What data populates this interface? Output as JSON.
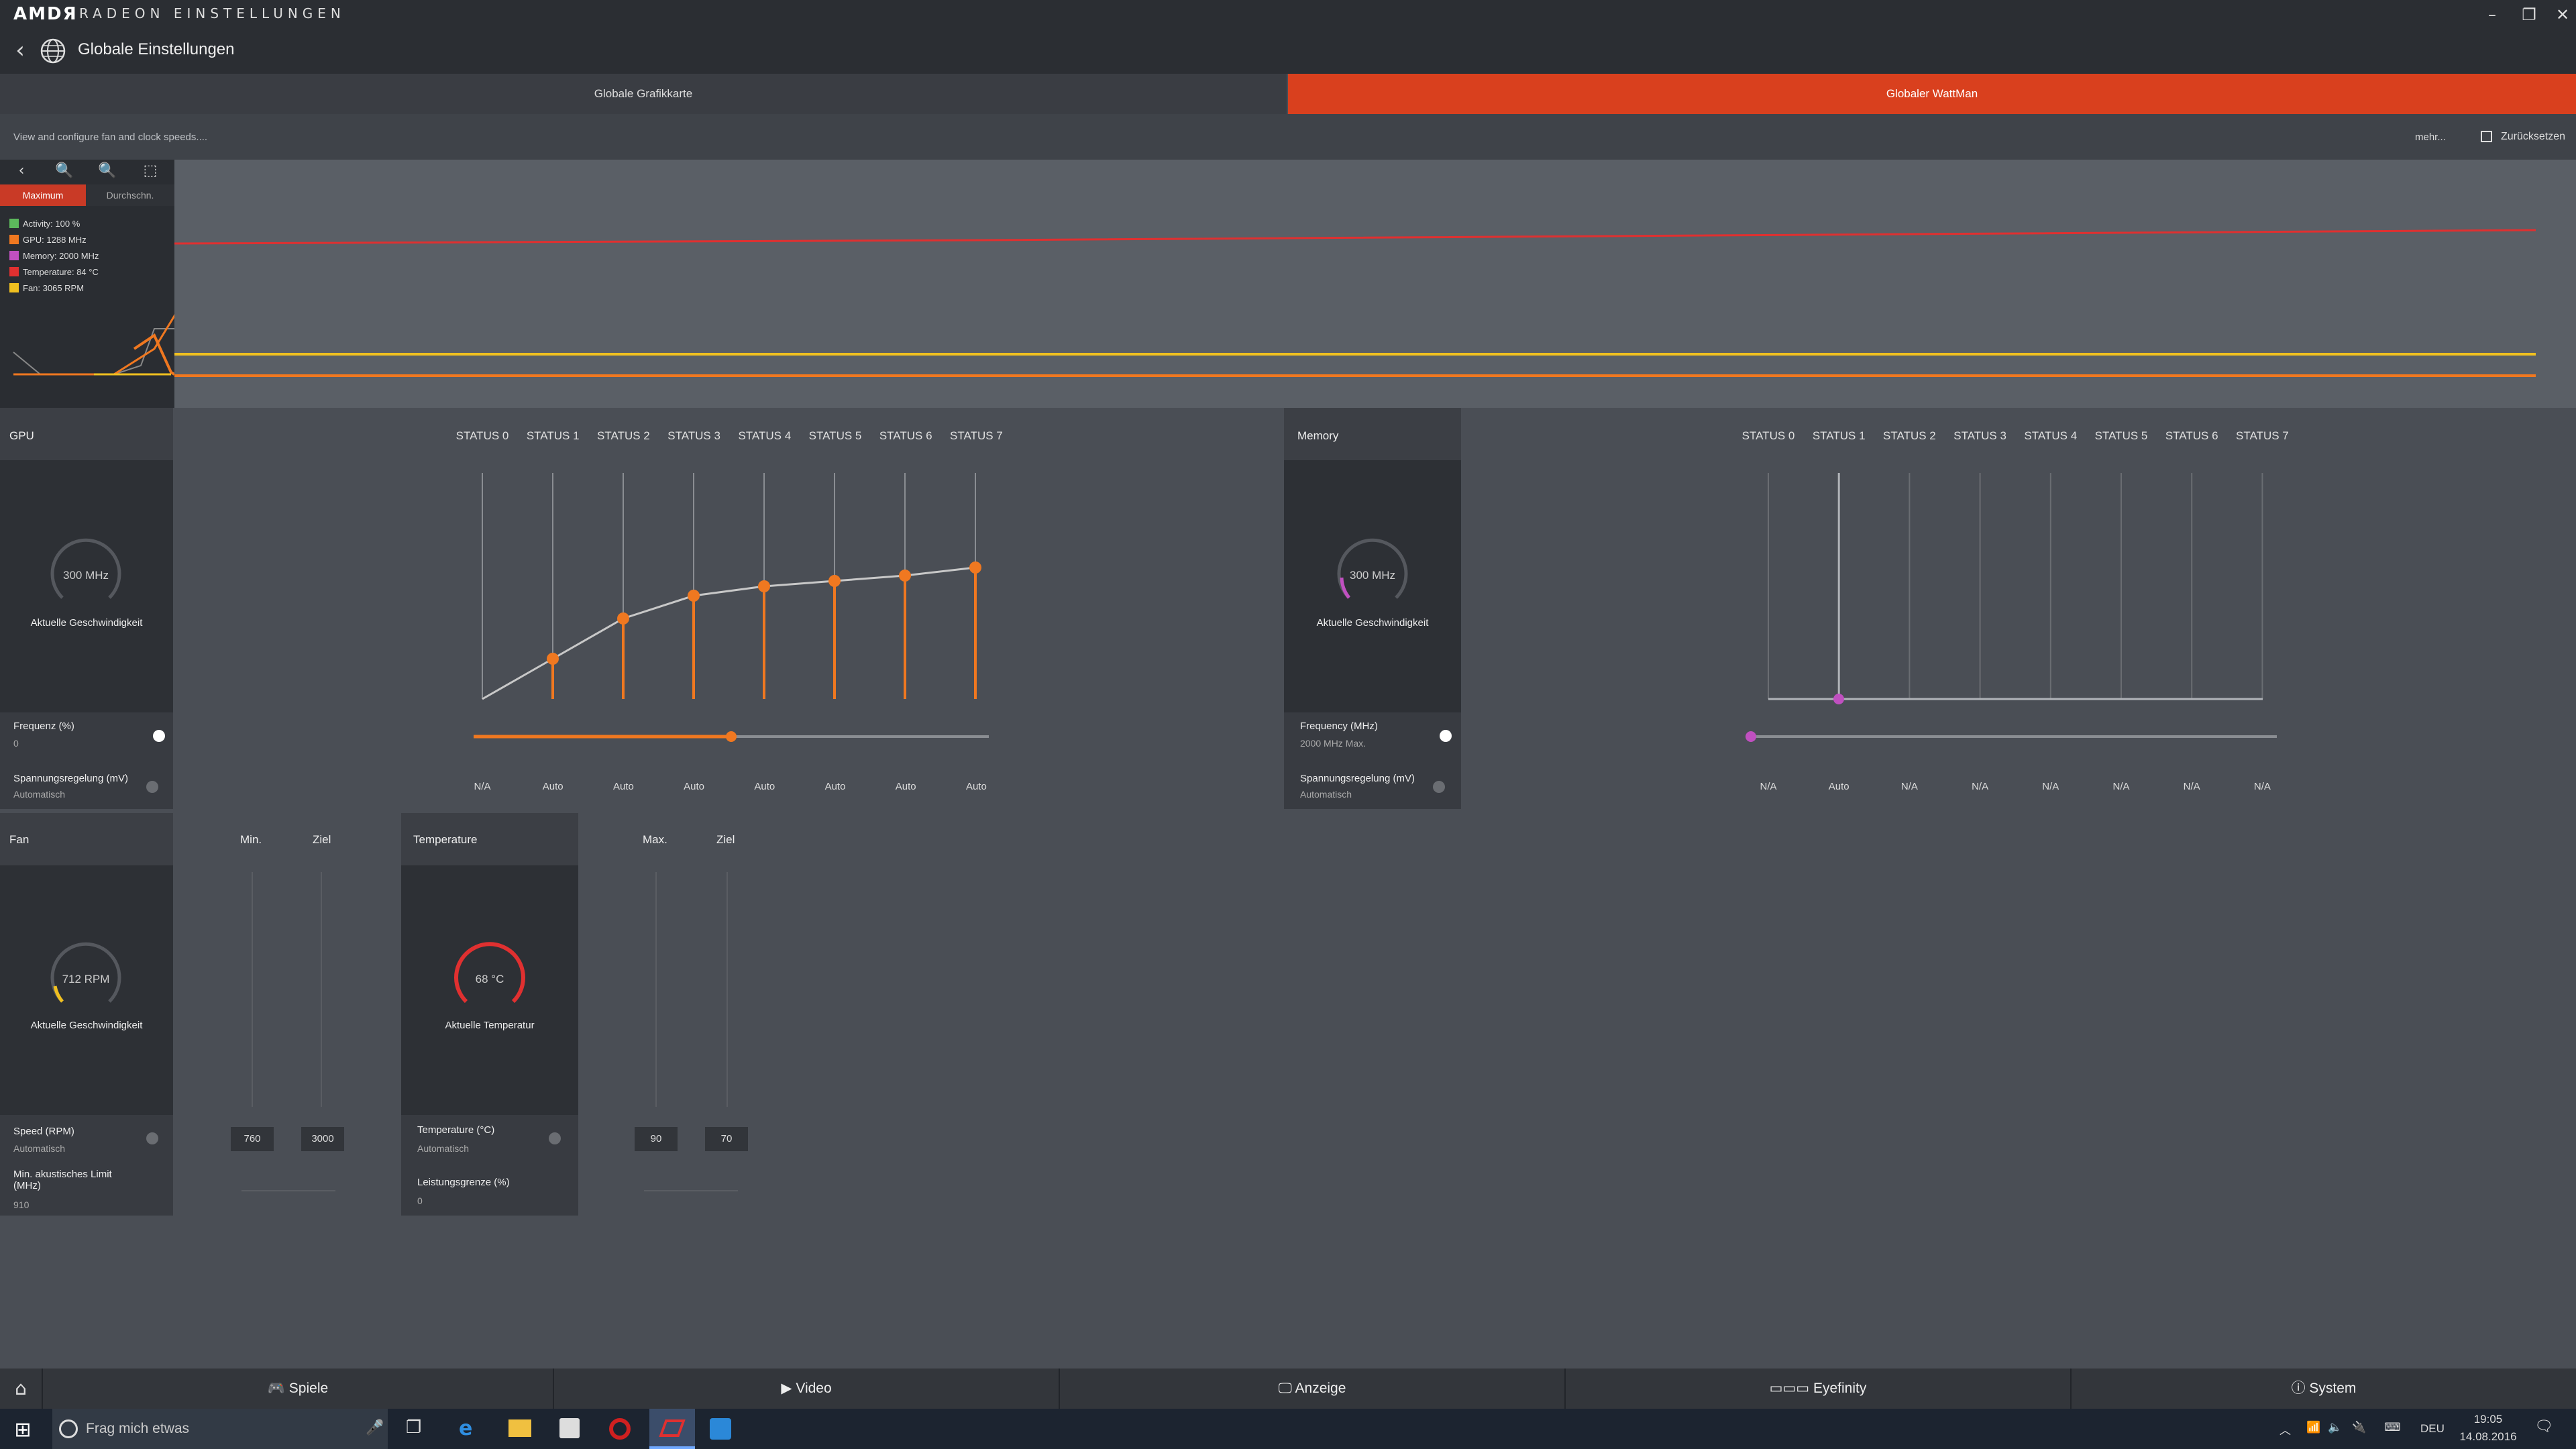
{
  "titlebar": {
    "logo": "AMDЯ",
    "app_title": "RADEON EINSTELLUNGEN",
    "minimize": "–",
    "maximize": "❐",
    "close": "✕"
  },
  "header": {
    "back": "‹",
    "title": "Globale Einstellungen"
  },
  "tabs": [
    {
      "label": "Globale Grafikkarte"
    },
    {
      "label": "Globaler WattMan"
    }
  ],
  "infobar": {
    "text": "View and configure fan and clock speeds....",
    "more": "mehr...",
    "reset": "Zurücksetzen"
  },
  "monitor": {
    "toolbar": [
      "‹",
      "🔍",
      "🔍",
      "⬚"
    ],
    "mode_max": "Maximum",
    "mode_avg": "Durchschn.",
    "legend": [
      {
        "label": "Activity: 100 %",
        "color": "#5cb85c"
      },
      {
        "label": "GPU: 1288 MHz",
        "color": "#f07820"
      },
      {
        "label": "Memory: 2000 MHz",
        "color": "#c050c0"
      },
      {
        "label": "Temperature: 84 °C",
        "color": "#e03030"
      },
      {
        "label": "Fan: 3065 RPM",
        "color": "#f0c020"
      }
    ]
  },
  "gpu": {
    "title": "GPU",
    "states": [
      "STATUS 0",
      "STATUS 1",
      "STATUS 2",
      "STATUS 3",
      "STATUS 4",
      "STATUS 5",
      "STATUS 6",
      "STATUS 7"
    ],
    "gauge_value": "300 MHz",
    "gauge_label": "Aktuelle Geschwindigkeit",
    "freq_label": "Frequenz (%)",
    "freq_value": "0",
    "freq_slider": 0.5,
    "volt_label": "Spannungsregelung (mV)",
    "volt_value": "Automatisch",
    "volt_states": [
      "N/A",
      "Auto",
      "Auto",
      "Auto",
      "Auto",
      "Auto",
      "Auto",
      "Auto"
    ]
  },
  "memory": {
    "title": "Memory",
    "states": [
      "STATUS 0",
      "STATUS 1",
      "STATUS 2",
      "STATUS 3",
      "STATUS 4",
      "STATUS 5",
      "STATUS 6",
      "STATUS 7"
    ],
    "gauge_value": "300 MHz",
    "gauge_label": "Aktuelle Geschwindigkeit",
    "freq_label": "Frequency (MHz)",
    "freq_value": "2000 MHz Max.",
    "freq_slider": 0,
    "volt_label": "Spannungsregelung (mV)",
    "volt_value": "Automatisch",
    "volt_states": [
      "N/A",
      "Auto",
      "N/A",
      "N/A",
      "N/A",
      "N/A",
      "N/A",
      "N/A"
    ]
  },
  "fan": {
    "title": "Fan",
    "col_min": "Min.",
    "col_target": "Ziel",
    "gauge_value": "712 RPM",
    "gauge_label": "Aktuelle Geschwindigkeit",
    "speed_label": "Speed (RPM)",
    "speed_value": "Automatisch",
    "min_value": "760",
    "target_value": "3000",
    "acoustic_label": "Min. akustisches Limit (MHz)",
    "acoustic_value": "910"
  },
  "temperature": {
    "title": "Temperature",
    "col_max": "Max.",
    "col_target": "Ziel",
    "gauge_value": "68 °C",
    "gauge_label": "Aktuelle Temperatur",
    "temp_label": "Temperature (°C)",
    "temp_value": "Automatisch",
    "max_value": "90",
    "target_value": "70",
    "power_label": "Leistungsgrenze (%)",
    "power_value": "0"
  },
  "bottom_tabs": [
    {
      "label": "Spiele"
    },
    {
      "label": "Video"
    },
    {
      "label": "Anzeige"
    },
    {
      "label": "Eyefinity"
    },
    {
      "label": "System"
    }
  ],
  "taskbar": {
    "search_placeholder": "Frag mich etwas",
    "lang": "DEU",
    "time": "19:05",
    "date": "14.08.2016"
  },
  "colors": {
    "accent": "#d9401e",
    "gpu_curve": "#f07820",
    "memory": "#c050c0",
    "temp": "#e03030",
    "fan": "#f0c020"
  }
}
